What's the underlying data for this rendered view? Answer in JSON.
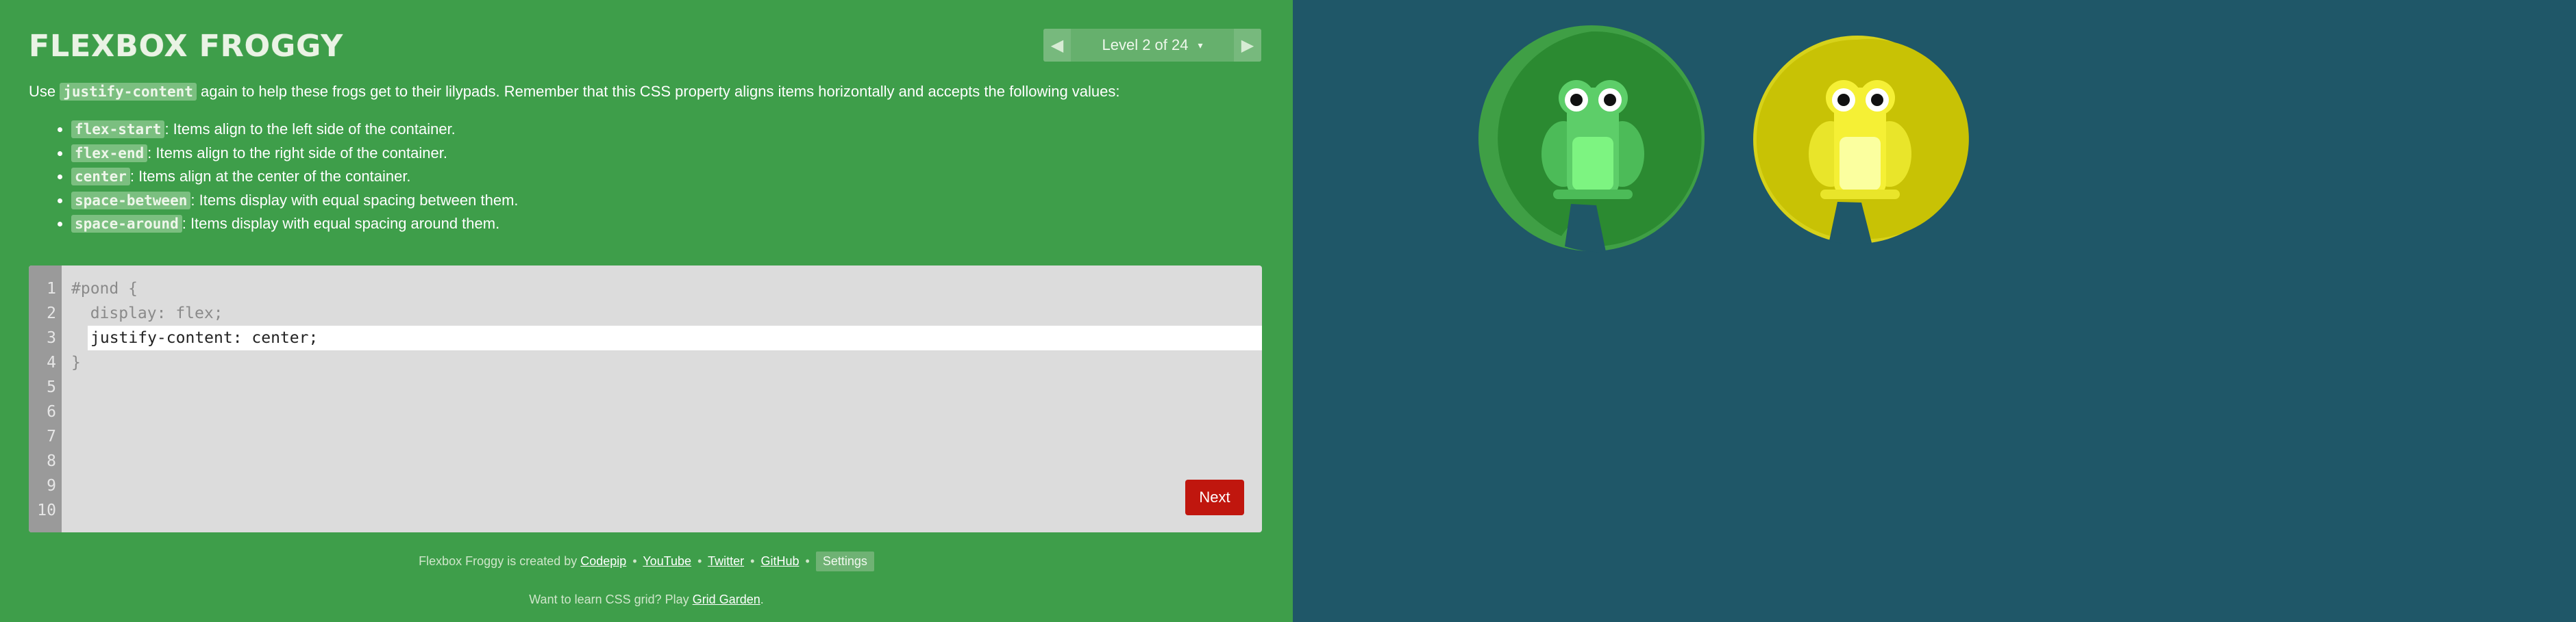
{
  "app": {
    "title": "FLEXBOX FROGGY"
  },
  "level_nav": {
    "prev_icon": "triangle-left-icon",
    "label": "Level 2 of 24",
    "caret": "▾",
    "next_icon": "triangle-right-icon"
  },
  "instructions": {
    "intro_before": "Use ",
    "intro_code": "justify-content",
    "intro_after": " again to help these frogs get to their lilypads. Remember that this CSS property aligns items horizontally and accepts the following values:",
    "values": [
      {
        "code": "flex-start",
        "desc": ": Items align to the left side of the container."
      },
      {
        "code": "flex-end",
        "desc": ": Items align to the right side of the container."
      },
      {
        "code": "center",
        "desc": ": Items align at the center of the container."
      },
      {
        "code": "space-between",
        "desc": ": Items display with equal spacing between them."
      },
      {
        "code": "space-around",
        "desc": ": Items display with equal spacing around them."
      }
    ]
  },
  "editor": {
    "line_numbers": [
      "1",
      "2",
      "3",
      "4",
      "5",
      "6",
      "7",
      "8",
      "9",
      "10"
    ],
    "line1": "#pond {",
    "line2": "  display: flex;",
    "input_value": "justify-content: center;",
    "line4": "}",
    "next_label": "Next"
  },
  "footer": {
    "credits_prefix": "Flexbox Froggy is created by ",
    "codepip": "Codepip",
    "youtube": "YouTube",
    "twitter": "Twitter",
    "github": "GitHub",
    "separator": "•",
    "settings": "Settings",
    "note_prefix": "Want to learn CSS grid? Play ",
    "note_link": "Grid Garden",
    "note_suffix": "."
  },
  "pond": {
    "frogs": [
      {
        "color": "green",
        "body": "#5dce69",
        "belly": "#7df481",
        "pad": "#2b8a31",
        "pad_rim": "#3f9f45"
      },
      {
        "color": "yellow",
        "body": "#f5f035",
        "belly": "#fbff9f",
        "pad": "#c8c205",
        "pad_rim": "#d7d21a"
      }
    ],
    "colors": {
      "background": "#1f5768",
      "sidebar": "#3e9e4a",
      "next_button": "#c0160e"
    }
  }
}
